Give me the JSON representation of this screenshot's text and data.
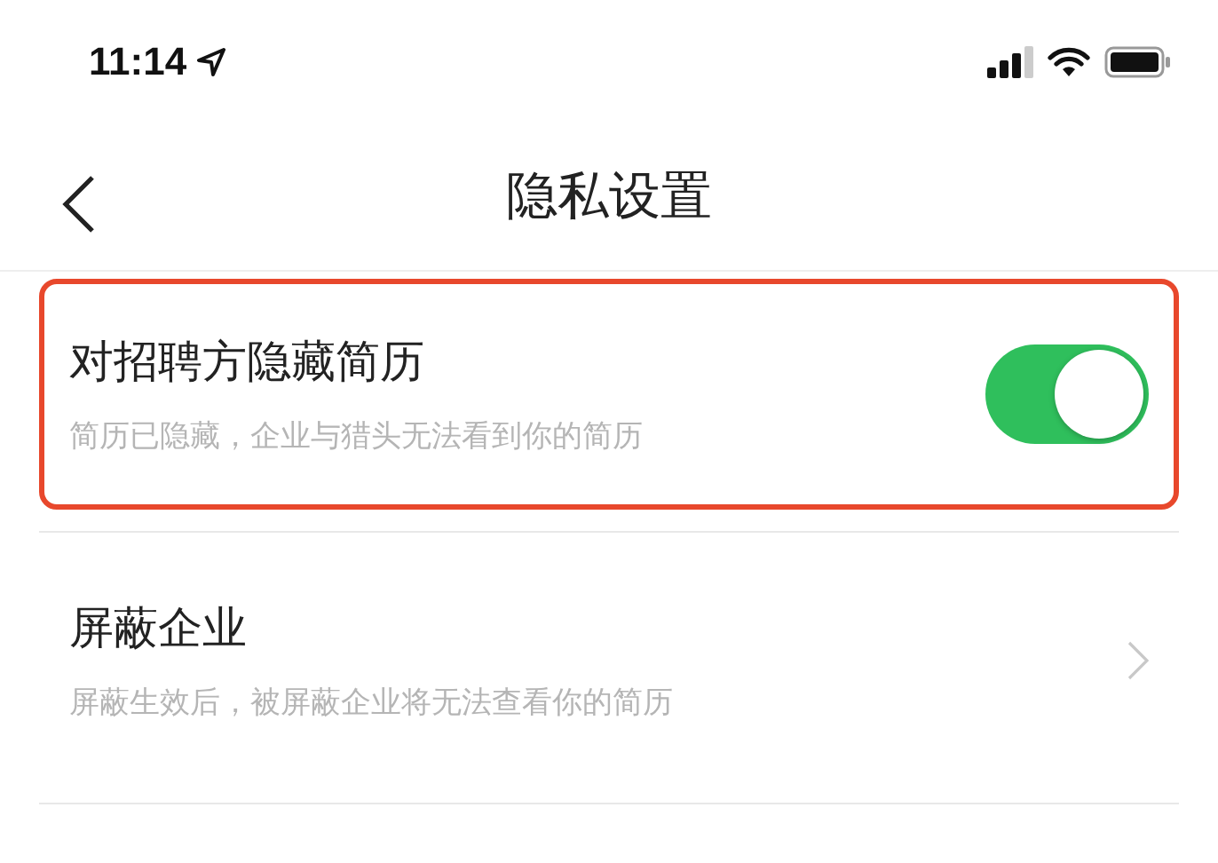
{
  "status_bar": {
    "time": "11:14"
  },
  "nav": {
    "title": "隐私设置"
  },
  "rows": [
    {
      "kind": "toggle",
      "title": "对招聘方隐藏简历",
      "subtitle": "简历已隐藏，企业与猎头无法看到你的简历",
      "on": true,
      "highlighted": true
    },
    {
      "kind": "link",
      "title": "屏蔽企业",
      "subtitle": "屏蔽生效后，被屏蔽企业将无法查看你的简历",
      "highlighted": false
    }
  ]
}
